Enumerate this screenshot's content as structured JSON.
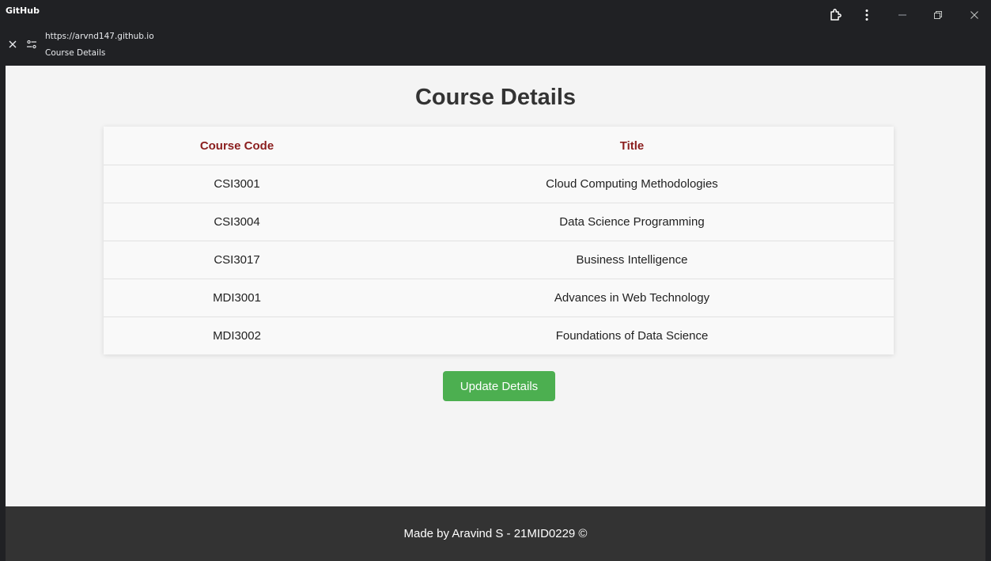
{
  "window": {
    "app_name": "GitHub",
    "url": "https://arvnd147.github.io",
    "page_title": "Course Details"
  },
  "icons": {
    "close": "close-icon",
    "site_settings": "site-settings-icon",
    "extensions": "extension-icon",
    "menu": "more-vert-icon",
    "minimize": "minimize-icon",
    "restore": "restore-icon",
    "close_window": "close-window-icon"
  },
  "main": {
    "heading": "Course Details",
    "table": {
      "headers": [
        "Course Code",
        "Title"
      ],
      "rows": [
        [
          "CSI3001",
          "Cloud Computing Methodologies"
        ],
        [
          "CSI3004",
          "Data Science Programming"
        ],
        [
          "CSI3017",
          "Business Intelligence"
        ],
        [
          "MDI3001",
          "Advances in Web Technology"
        ],
        [
          "MDI3002",
          "Foundations of Data Science"
        ]
      ]
    },
    "update_button_label": "Update Details"
  },
  "footer": {
    "text": "Made by Aravind S - 21MID0229 ©"
  },
  "colors": {
    "header_text": "#8b1e1e",
    "button_bg": "#4caf50",
    "footer_bg": "#333333",
    "titlebar_bg": "#202124",
    "page_bg": "#f4f4f4"
  }
}
